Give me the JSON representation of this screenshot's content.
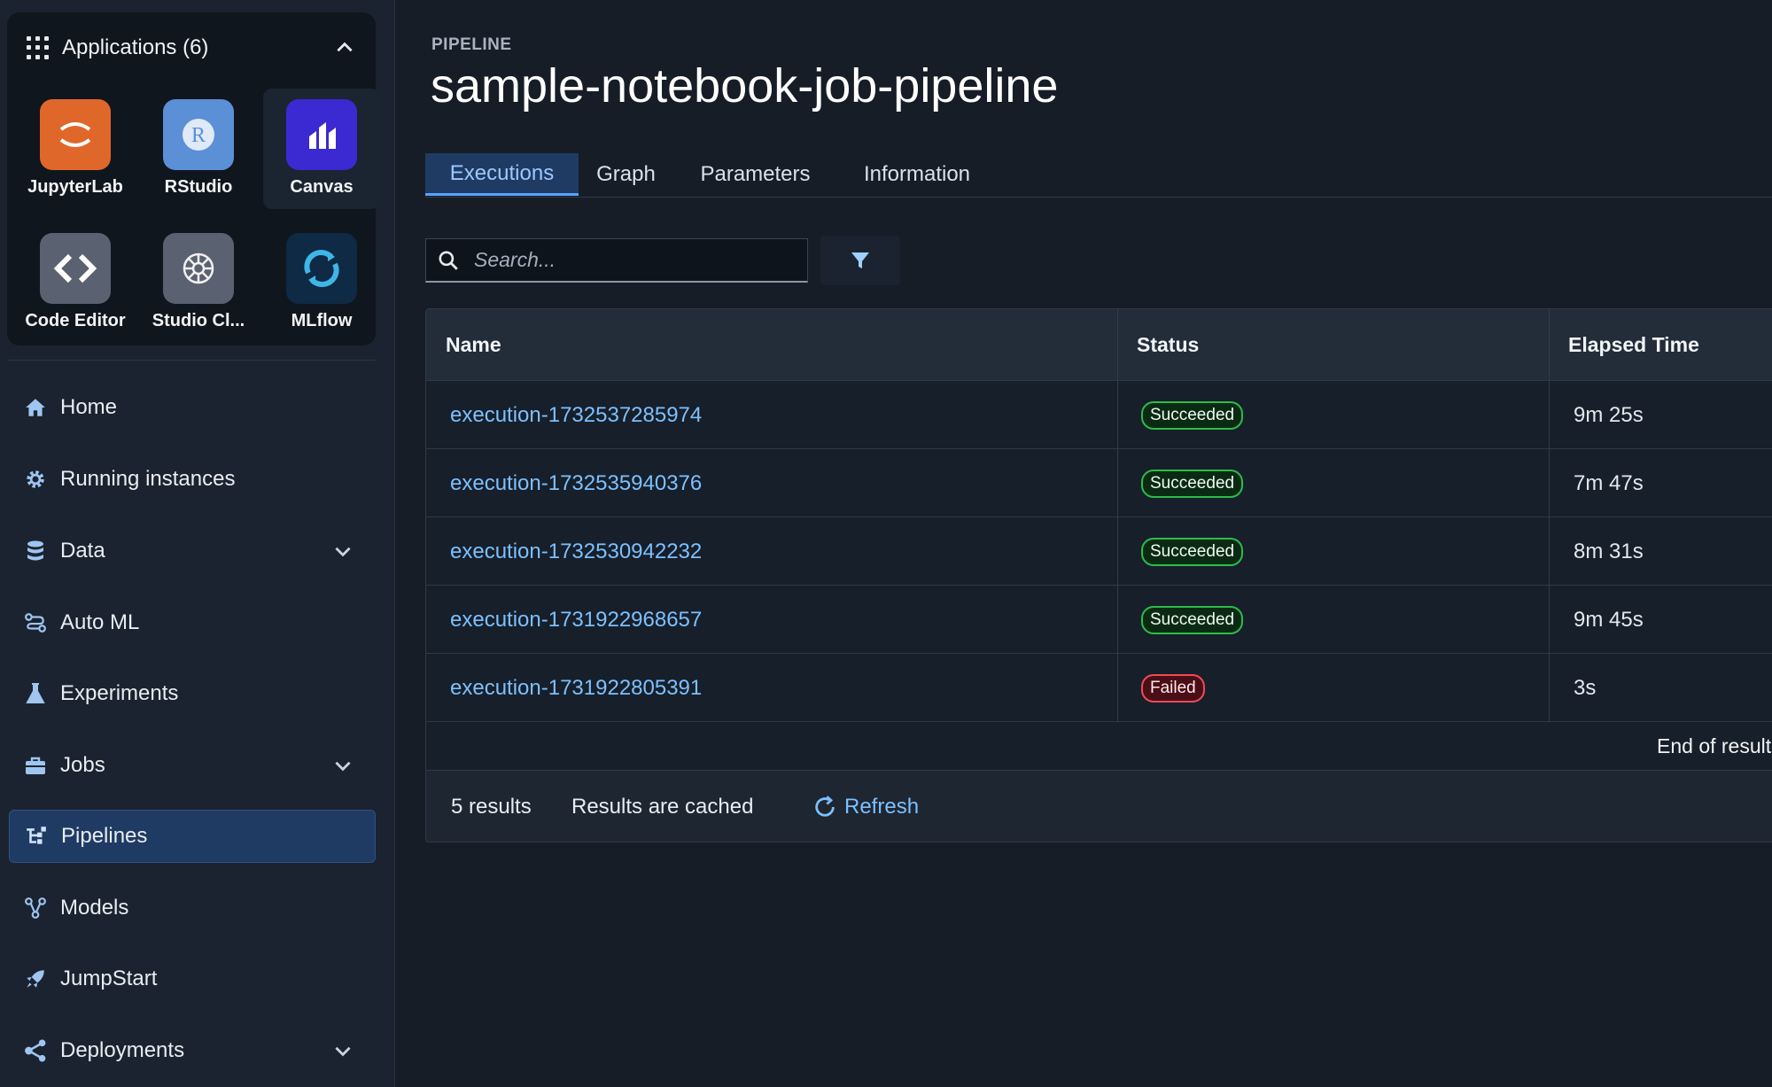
{
  "sidebar": {
    "apps_title": "Applications (6)",
    "apps": [
      {
        "label": "JupyterLab",
        "icon": "jupyterlab-icon",
        "color": "#e0672a"
      },
      {
        "label": "RStudio",
        "icon": "rstudio-icon",
        "color": "#5b8fd6"
      },
      {
        "label": "Canvas",
        "icon": "canvas-icon",
        "color": "#3b2ad1"
      },
      {
        "label": "Code Editor",
        "icon": "code-editor-icon",
        "color": "#5a6170"
      },
      {
        "label": "Studio Cl...",
        "icon": "studio-classic-icon",
        "color": "#5a6170"
      },
      {
        "label": "MLflow",
        "icon": "mlflow-icon",
        "color": "#0f2a44"
      }
    ],
    "nav": [
      {
        "label": "Home",
        "icon": "home-icon"
      },
      {
        "label": "Running instances",
        "icon": "gear-icon"
      },
      {
        "label": "Data",
        "icon": "database-icon",
        "expandable": true
      },
      {
        "label": "Auto ML",
        "icon": "automl-icon"
      },
      {
        "label": "Experiments",
        "icon": "flask-icon"
      },
      {
        "label": "Jobs",
        "icon": "briefcase-icon",
        "expandable": true
      },
      {
        "label": "Pipelines",
        "icon": "pipeline-icon",
        "active": true
      },
      {
        "label": "Models",
        "icon": "models-icon"
      },
      {
        "label": "JumpStart",
        "icon": "rocket-icon"
      },
      {
        "label": "Deployments",
        "icon": "share-icon",
        "expandable": true
      }
    ]
  },
  "main": {
    "eyebrow": "PIPELINE",
    "title": "sample-notebook-job-pipeline",
    "tabs": [
      "Executions",
      "Graph",
      "Parameters",
      "Information"
    ],
    "active_tab": "Executions",
    "search": {
      "placeholder": "Search..."
    },
    "table": {
      "columns": [
        "Name",
        "Status",
        "Elapsed Time"
      ],
      "rows": [
        {
          "name": "execution-1732537285974",
          "status": "Succeeded",
          "elapsed": "9m 25s"
        },
        {
          "name": "execution-1732535940376",
          "status": "Succeeded",
          "elapsed": "7m 47s"
        },
        {
          "name": "execution-1732530942232",
          "status": "Succeeded",
          "elapsed": "8m 31s"
        },
        {
          "name": "execution-1731922968657",
          "status": "Succeeded",
          "elapsed": "9m 45s"
        },
        {
          "name": "execution-1731922805391",
          "status": "Failed",
          "elapsed": "3s"
        }
      ],
      "end_text": "End of results"
    },
    "footer": {
      "count": "5 results",
      "cached": "Results are cached",
      "refresh": "Refresh"
    }
  },
  "colors": {
    "accent": "#5aa3ff",
    "link": "#7cc0ff",
    "success": "#2bbd4a",
    "failure": "#f04a56"
  }
}
